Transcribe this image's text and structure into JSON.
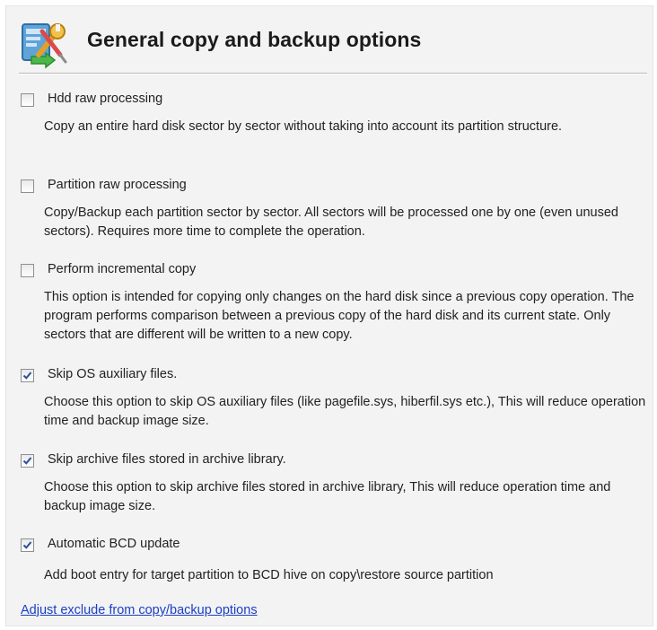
{
  "header": {
    "title": "General copy and backup options",
    "icon": "settings-wrench-icon"
  },
  "options": [
    {
      "label": "Hdd raw processing",
      "checked": false,
      "description": "Copy an entire hard disk sector by sector without taking into account its partition structure."
    },
    {
      "label": "Partition raw processing",
      "checked": false,
      "description": "Copy/Backup each partition sector by sector. All sectors will be processed one by one (even unused sectors). Requires more time to complete the operation."
    },
    {
      "label": "Perform incremental copy",
      "checked": false,
      "description": "This option is intended for copying only changes on the hard disk since a previous copy operation. The program performs comparison between a previous copy of the hard disk and its current state. Only sectors that are different will be written to a new copy."
    },
    {
      "label": "Skip OS auxiliary files.",
      "checked": true,
      "description": "Choose this option to skip OS auxiliary files (like pagefile.sys, hiberfil.sys etc.), This will reduce operation time and backup image size."
    },
    {
      "label": "Skip archive files stored in archive library.",
      "checked": true,
      "description": "Choose this option to skip archive files stored in archive library, This will reduce operation time and backup image size."
    },
    {
      "label": "Automatic BCD update",
      "checked": true,
      "description": "Add boot entry for target partition to BCD hive on copy\\restore source partition"
    }
  ],
  "footer": {
    "link_label": "Adjust exclude from copy/backup options"
  },
  "colors": {
    "link": "#1a3fc7",
    "checkmark": "#2b4f9e"
  }
}
